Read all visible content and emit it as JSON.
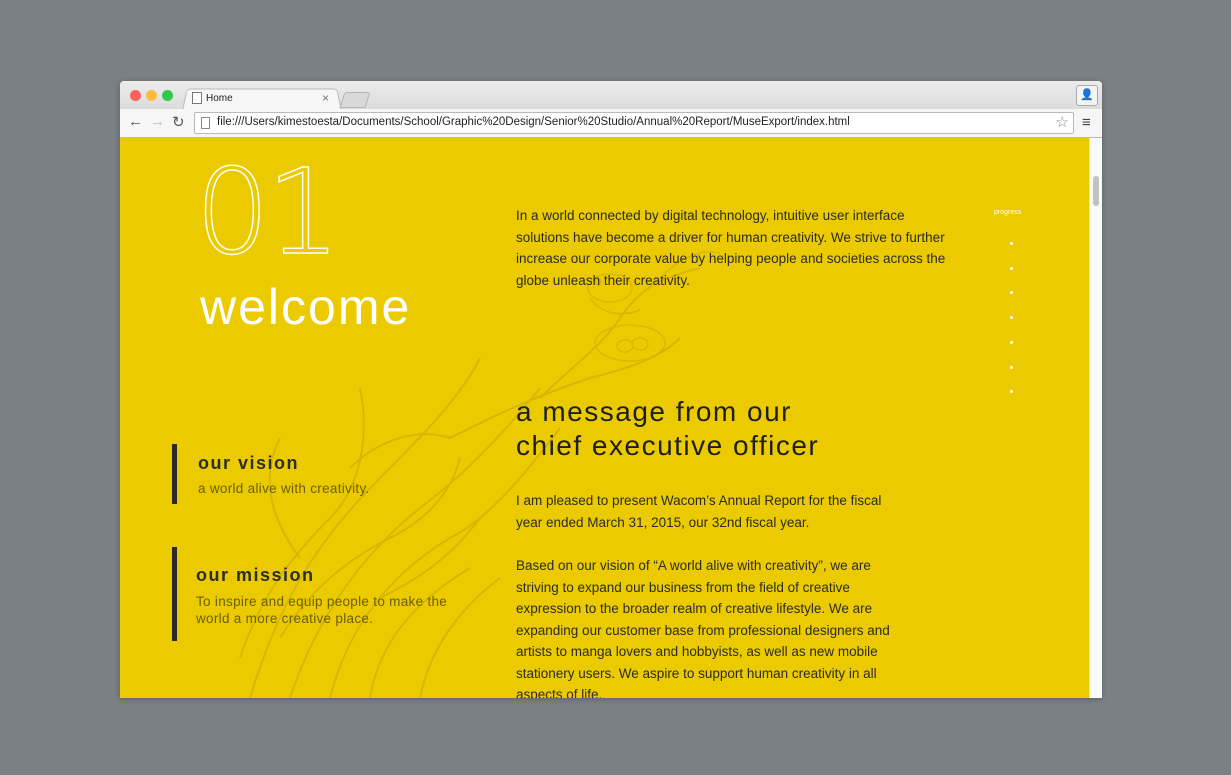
{
  "browser": {
    "tab_title": "Home",
    "tab_close": "×",
    "url": "file:///Users/kimestoesta/Documents/School/Graphic%20Design/Senior%20Studio/Annual%20Report/MuseExport/index.html",
    "back_icon": "←",
    "forward_icon": "→",
    "reload_icon": "↻",
    "star_icon": "☆",
    "menu_icon": "≡",
    "profile_icon": "👤"
  },
  "hero": {
    "number": "01",
    "title": "welcome",
    "intro": "In a world connected by digital technology, intuitive user interface solutions have become a driver for human creativity. We strive to further increase our corporate value by helping people and societies across the globe unleash their creativity."
  },
  "progress": {
    "label": "progress",
    "dot_count": 7
  },
  "vision": {
    "title": "our vision",
    "text": "a world alive with creativity."
  },
  "mission": {
    "title": "our mission",
    "text": "To inspire and equip people to make the world a more creative place."
  },
  "ceo": {
    "heading_line1": "a message from our",
    "heading_line2": "chief executive officer",
    "paragraph1": "I am pleased to present Wacom’s Annual Report for the fiscal year ended March 31, 2015, our 32nd fiscal year.",
    "paragraph2": "Based on our vision of “A world alive with creativity”, we are striving to expand our business from the field of creative expression to the broader realm of creative lifestyle. We are expanding our customer base from professional designers and artists to manga lovers and hobbyists, as well as new mobile stationery users. We aspire to support human creativity in all aspects of life."
  },
  "colors": {
    "page_background": "#ebcb00",
    "desktop": "#7a8083",
    "accent_text": "#ffffff",
    "bar": "#2a2a2a"
  }
}
